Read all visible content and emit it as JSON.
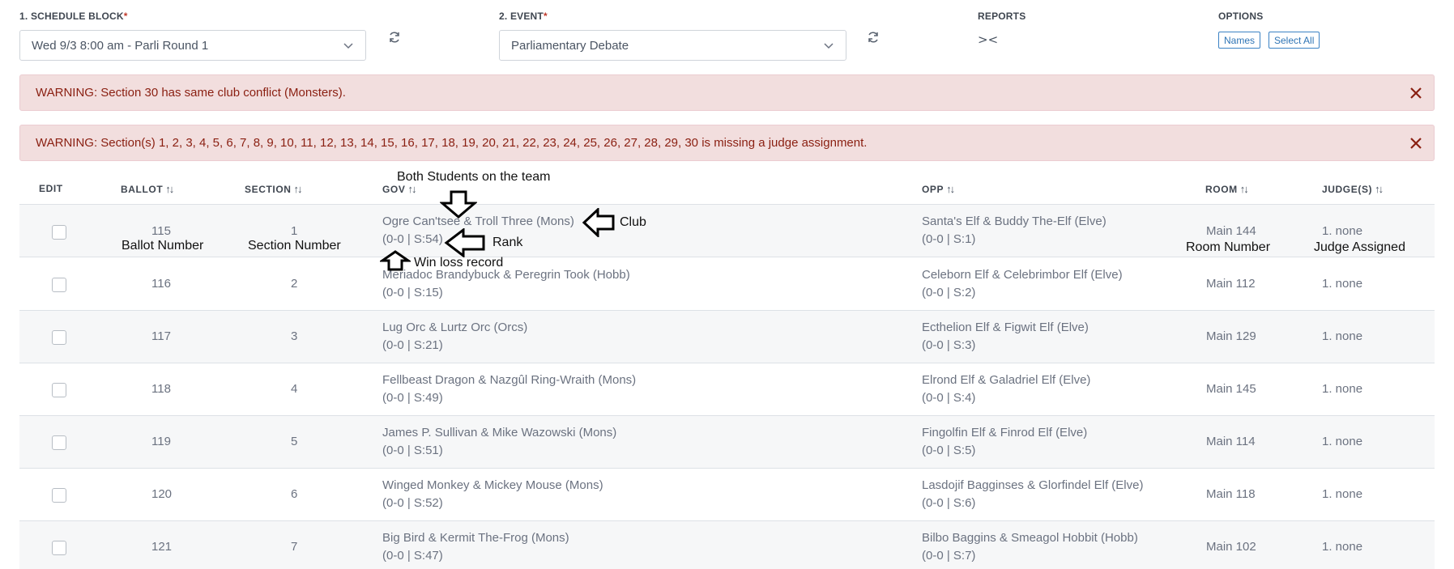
{
  "controls": {
    "schedule_label": "1. SCHEDULE BLOCK",
    "schedule_value": "Wed 9/3 8:00 am - Parli Round 1",
    "event_label": "2. EVENT",
    "event_value": "Parliamentary Debate",
    "required_mark": "*",
    "reports_label": "REPORTS",
    "reports_icon": "><",
    "options_label": "OPTIONS",
    "names_button": "Names",
    "select_all_button": "Select All"
  },
  "alerts": [
    {
      "text": "WARNING: Section 30 has same club conflict (Monsters).",
      "close": "close-icon"
    },
    {
      "text": "WARNING: Section(s) 1, 2, 3, 4, 5, 6, 7, 8, 9, 10, 11, 12, 13, 14, 15, 16, 17, 18, 19, 20, 21, 22, 23, 24, 25, 26, 27, 28, 29, 30 is missing a judge assignment.",
      "close": "close-icon"
    }
  ],
  "table": {
    "headers": {
      "edit": "EDIT",
      "ballot": "BALLOT",
      "section": "SECTION",
      "gov": "GOV",
      "opp": "OPP",
      "room": "ROOM",
      "judges": "JUDGE(S)"
    },
    "sort_glyph": "↑↓",
    "rows": [
      {
        "ballot": "115",
        "section": "1",
        "gov_names": "Ogre Can'tsee & Troll Three (Mons)",
        "gov_record": "(0-0 | S:54)",
        "opp_names": "Santa's Elf & Buddy The-Elf (Elve)",
        "opp_record": "(0-0 | S:1)",
        "room": "Main 144",
        "judge": "1. none"
      },
      {
        "ballot": "116",
        "section": "2",
        "gov_names": "Meriadoc Brandybuck & Peregrin Took (Hobb)",
        "gov_record": "(0-0 | S:15)",
        "opp_names": "Celeborn Elf & Celebrimbor Elf (Elve)",
        "opp_record": "(0-0 | S:2)",
        "room": "Main 112",
        "judge": "1. none"
      },
      {
        "ballot": "117",
        "section": "3",
        "gov_names": "Lug Orc & Lurtz Orc (Orcs)",
        "gov_record": "(0-0 | S:21)",
        "opp_names": "Ecthelion Elf & Figwit Elf (Elve)",
        "opp_record": "(0-0 | S:3)",
        "room": "Main 129",
        "judge": "1. none"
      },
      {
        "ballot": "118",
        "section": "4",
        "gov_names": "Fellbeast Dragon & Nazgûl Ring-Wraith (Mons)",
        "gov_record": "(0-0 | S:49)",
        "opp_names": "Elrond Elf & Galadriel Elf (Elve)",
        "opp_record": "(0-0 | S:4)",
        "room": "Main 145",
        "judge": "1. none"
      },
      {
        "ballot": "119",
        "section": "5",
        "gov_names": "James P. Sullivan & Mike Wazowski (Mons)",
        "gov_record": "(0-0 | S:51)",
        "opp_names": "Fingolfin Elf & Finrod Elf (Elve)",
        "opp_record": "(0-0 | S:5)",
        "room": "Main 114",
        "judge": "1. none"
      },
      {
        "ballot": "120",
        "section": "6",
        "gov_names": "Winged Monkey & Mickey Mouse (Mons)",
        "gov_record": "(0-0 | S:52)",
        "opp_names": "Lasdojif Bagginses & Glorfindel Elf (Elve)",
        "opp_record": "(0-0 | S:6)",
        "room": "Main 118",
        "judge": "1. none"
      },
      {
        "ballot": "121",
        "section": "7",
        "gov_names": "Big Bird & Kermit The-Frog (Mons)",
        "gov_record": "(0-0 | S:47)",
        "opp_names": "Bilbo Baggins & Smeagol Hobbit (Hobb)",
        "opp_record": "(0-0 | S:7)",
        "room": "Main 102",
        "judge": "1. none"
      }
    ]
  },
  "annotations": {
    "students": "Both Students on the team",
    "club": "Club",
    "rank": "Rank",
    "winloss": "Win loss record",
    "ballot_number": "Ballot Number",
    "section_number": "Section Number",
    "room_number": "Room Number",
    "judge_assigned": "Judge Assigned"
  }
}
